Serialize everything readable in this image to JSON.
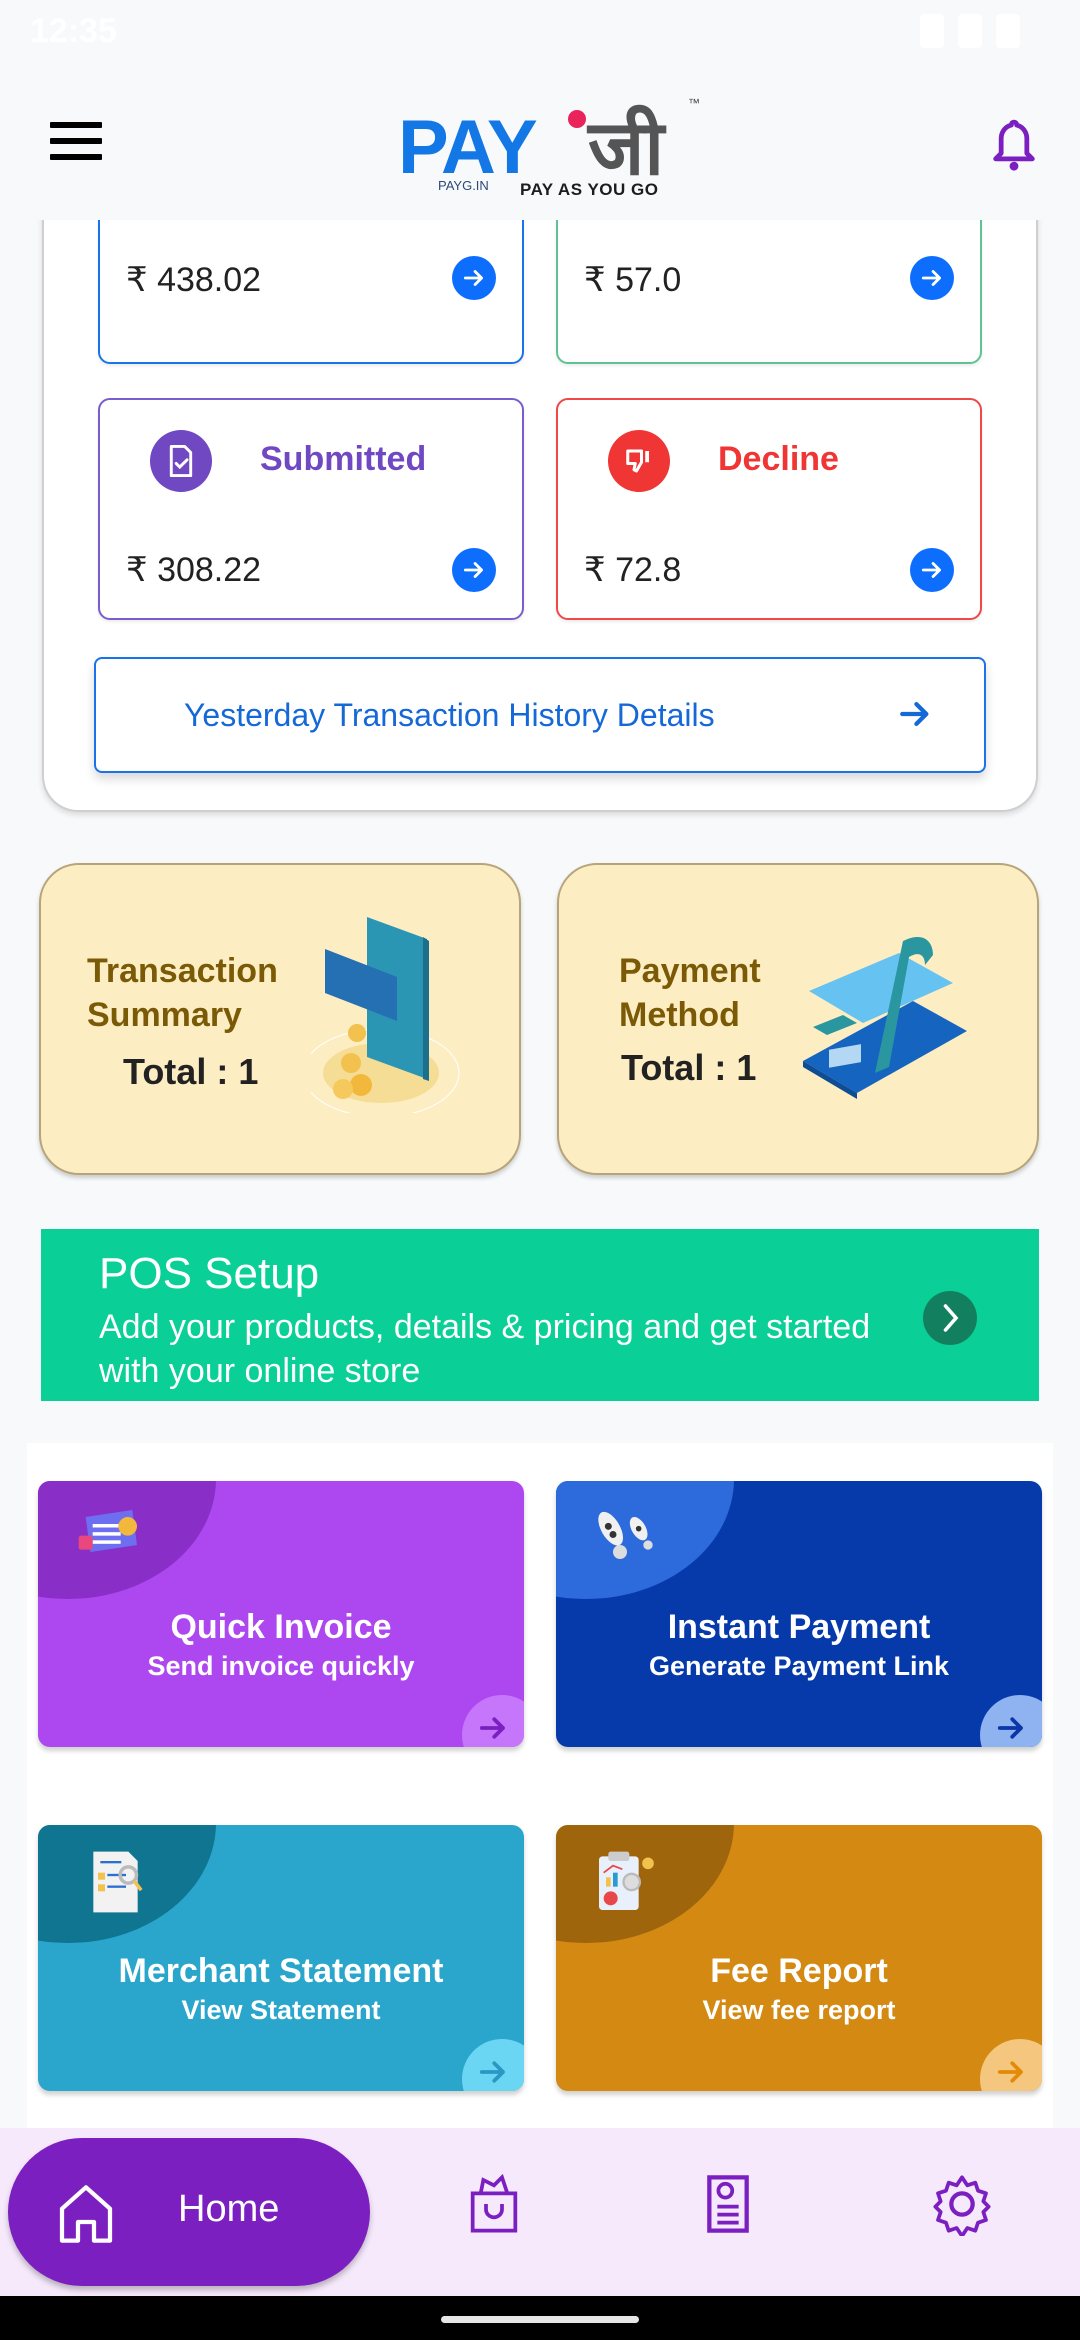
{
  "status_bar": {
    "time": "12:35"
  },
  "header": {
    "logo_main": "PAY",
    "logo_hindi": "जी",
    "logo_tm": "™",
    "logo_domain": "PAYG.IN",
    "logo_tagline": "PAY AS YOU GO",
    "menu_icon": "hamburger-menu-icon",
    "notification_icon": "bell-icon"
  },
  "summary": {
    "cards": [
      {
        "label": "",
        "amount": "₹ 438.02",
        "color": "#1a73e8",
        "icon": "document-icon"
      },
      {
        "label": "",
        "amount": "₹ 57.0",
        "color": "#3dba80",
        "icon": "approved-icon"
      },
      {
        "label": "Submitted",
        "amount": "₹ 308.22",
        "color": "#7048c2",
        "icon": "document-check-icon"
      },
      {
        "label": "Decline",
        "amount": "₹ 72.8",
        "color": "#f03535",
        "icon": "thumbs-down-icon"
      }
    ],
    "history_button": "Yesterday Transaction History Details"
  },
  "tiles": [
    {
      "title": "Transaction Summary",
      "total": "Total : 1",
      "illustration": "phone-card-coins-illustration"
    },
    {
      "title": "Payment Method",
      "total": "Total : 1",
      "illustration": "card-receipt-illustration"
    }
  ],
  "pos": {
    "title": "POS Setup",
    "description": "Add your products, details & pricing and get started with your online store",
    "color": "#0acf97"
  },
  "actions": [
    {
      "title": "Quick Invoice",
      "subtitle": "Send invoice quickly",
      "bg": "#ad48f0",
      "blob": "#8a2ec8",
      "corner": "#c576fa",
      "arrow": "#7b1fc0",
      "icon": "invoice-icon"
    },
    {
      "title": "Instant Payment",
      "subtitle": "Generate Payment Link",
      "bg": "#063aab",
      "blob": "#2d6bdc",
      "corner": "#8fb2f0",
      "arrow": "#0a36a8",
      "icon": "rocket-icon"
    },
    {
      "title": "Merchant Statement",
      "subtitle": "View Statement",
      "bg": "#2aa5cb",
      "blob": "#0f7591",
      "corner": "#6bd6f4",
      "arrow": "#2a98c2",
      "icon": "statement-icon"
    },
    {
      "title": "Fee Report",
      "subtitle": "View fee report",
      "bg": "#d38912",
      "blob": "#9f650c",
      "corner": "#f5c67d",
      "arrow": "#e38a06",
      "icon": "report-icon"
    }
  ],
  "bottom_nav": {
    "active_label": "Home",
    "items": [
      "home-icon",
      "shopping-bag-icon",
      "receipt-icon",
      "settings-gear-icon"
    ],
    "accent": "#7b1fc0"
  }
}
